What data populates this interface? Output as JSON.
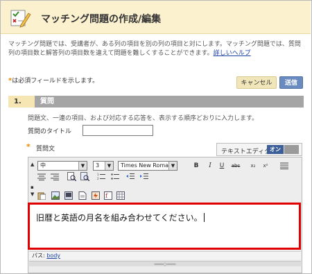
{
  "header": {
    "title": "マッチング問題の作成/編集",
    "icon": "checklist-edit-icon"
  },
  "description": {
    "text": "マッチング問題では、受講者が、ある列の項目を別の列の項目と対にします。マッチング問題では、質問列の項目数と解答列の項目数を違えて問題を難しくすることができます。",
    "link": "詳しいヘルプ"
  },
  "required_note": {
    "star": "*",
    "text": "は必須フィールドを示します。"
  },
  "actions": {
    "cancel": "キャンセル",
    "submit": "送信"
  },
  "section": {
    "number": "1.",
    "title": "質問",
    "description": "問題文、一連の項目、および対応する応答を、表示する順序どおりに入力します。"
  },
  "form": {
    "title_label": "質問のタイトル",
    "title_value": "",
    "question_label": "質問文",
    "required_star": "*"
  },
  "editor": {
    "toggle_label": "テキストエディタ:",
    "toggle_on": "オン",
    "format_select": "中",
    "size_select": "3",
    "font_select": "Times New Roman",
    "content": "旧暦と英語の月名を組み合わせてください。",
    "path_label": "パス:",
    "path_link": "body",
    "toolbar": {
      "bold": "B",
      "italic": "I",
      "underline": "U",
      "strike": "abc",
      "subscript": "x₂",
      "superscript": "x²"
    }
  },
  "colors": {
    "header_bg": "#fbf1cf",
    "submit_bg": "#6a8bbf",
    "highlight": "#e00000",
    "section_bar": "#a5a5a5"
  }
}
